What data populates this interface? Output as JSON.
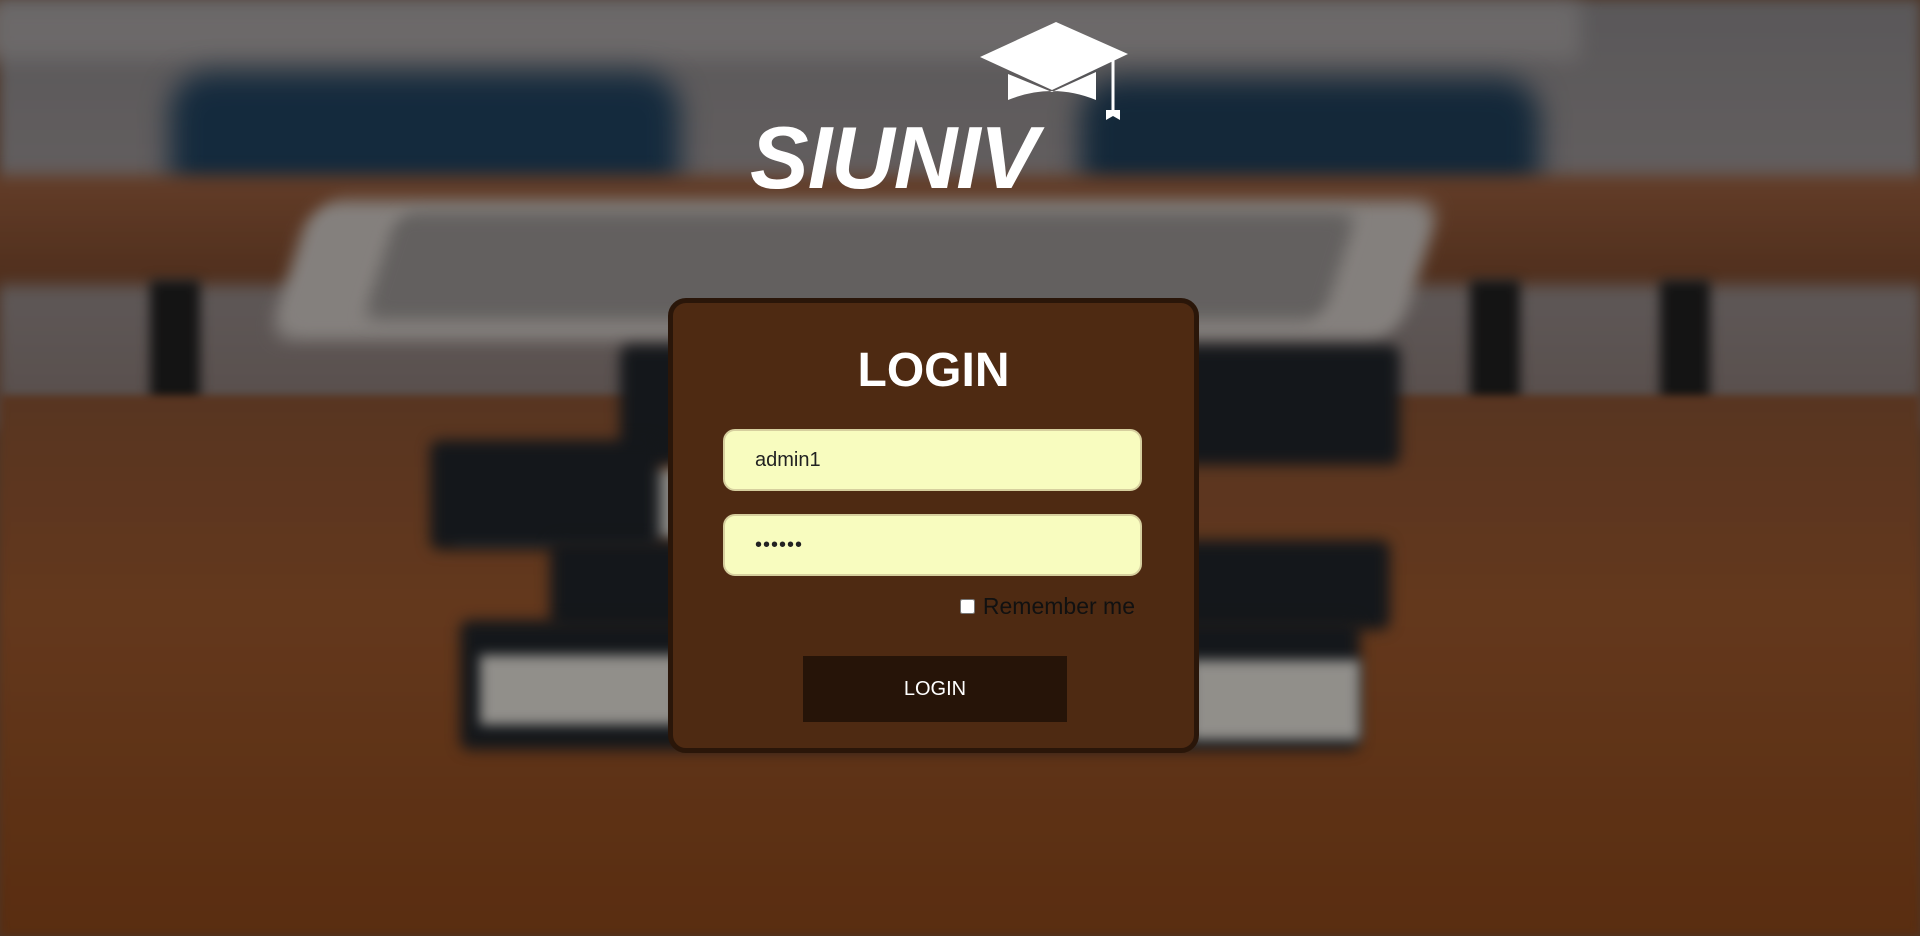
{
  "logo": {
    "text": "SIUNIV",
    "icon": "graduation-cap-icon"
  },
  "login_card": {
    "title": "LOGIN",
    "username": {
      "value": "admin1",
      "placeholder": ""
    },
    "password": {
      "value": "••••••",
      "placeholder": ""
    },
    "remember_label": "Remember me",
    "remember_checked": false,
    "button_label": "LOGIN"
  },
  "colors": {
    "card_background": "#4e2a12",
    "card_border": "#2a1609",
    "input_background": "#f8fcbf",
    "button_background": "#261408",
    "text_light": "#ffffff"
  }
}
